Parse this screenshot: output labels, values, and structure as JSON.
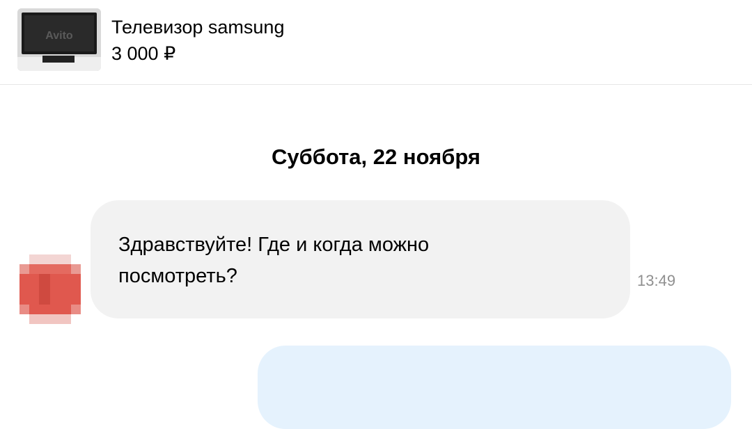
{
  "listing": {
    "title": "Телевизор samsung",
    "price": "3 000 ₽",
    "thumbnail_icon": "tv-product-photo",
    "watermark": "Avito"
  },
  "chat": {
    "date_separator": "Суббота, 22 ноября",
    "messages": [
      {
        "direction": "incoming",
        "text": "Здравствуйте! Где и когда можно посмотреть?",
        "time": "13:49",
        "avatar_color": "#e0584e"
      },
      {
        "direction": "outgoing",
        "text": "",
        "bubble_color": "#e5f2fd"
      }
    ]
  },
  "colors": {
    "incoming_bubble": "#f2f2f2",
    "outgoing_bubble": "#e5f2fd",
    "timestamp": "#8f8f8f"
  }
}
